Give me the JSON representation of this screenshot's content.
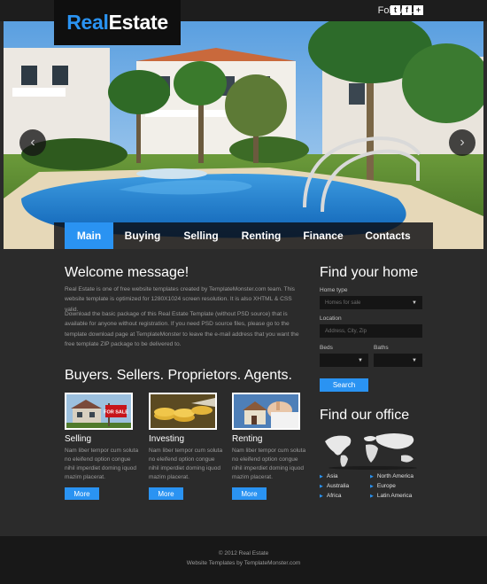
{
  "brand": {
    "part1": "Real",
    "part2": "Estate"
  },
  "header": {
    "follow_label": "Follow Us:",
    "social": [
      "twitter-icon",
      "facebook-icon",
      "plus-icon"
    ]
  },
  "nav": {
    "items": [
      {
        "label": "Main",
        "active": true
      },
      {
        "label": "Buying"
      },
      {
        "label": "Selling"
      },
      {
        "label": "Renting"
      },
      {
        "label": "Finance"
      },
      {
        "label": "Contacts"
      }
    ]
  },
  "welcome": {
    "title": "Welcome message!",
    "p1": "Real Estate is one of free website templates created by TemplateMonster.com team. This website template is optimized for 1280X1024 screen resolution. It is also XHTML & CSS valid.",
    "p2": "Download the basic package of this Real Estate Template (without PSD source) that is available for anyone without registration. If you need PSD source files, please go to the template download page at TemplateMonster to leave the e-mail address that you want the free template ZIP package to be delivered to."
  },
  "buyers": {
    "title": "Buyers. Sellers. Proprietors. Agents.",
    "cards": [
      {
        "title": "Selling",
        "text": "Nam liber tempor cum soluta no eleifend option congue nihil imperdiet doming iquod mazim placerat.",
        "button": "More",
        "sign": "FOR SALE"
      },
      {
        "title": "Investing",
        "text": "Nam liber tempor cum soluta no eleifend option congue nihil imperdiet doming iquod mazim placerat.",
        "button": "More"
      },
      {
        "title": "Renting",
        "text": "Nam liber tempor cum soluta no eleifend option congue nihil imperdiet doming iquod mazim placerat.",
        "button": "More"
      }
    ]
  },
  "find_home": {
    "title": "Find your home",
    "home_type_label": "Home type",
    "home_type_value": "Homes for sale",
    "location_label": "Location",
    "location_placeholder": "Address, City, Zip",
    "beds_label": "Beds",
    "baths_label": "Baths",
    "search_button": "Search"
  },
  "office": {
    "title": "Find our office",
    "col1": [
      "Asia",
      "Australia",
      "Africa"
    ],
    "col2": [
      "North America",
      "Europe",
      "Latin America"
    ]
  },
  "footer": {
    "line1": "© 2012 Real Estate",
    "line2": "Website Templates by TemplateMonster.com"
  },
  "colors": {
    "accent": "#2a93f2",
    "background": "#2b2b2b",
    "footer": "#181818"
  }
}
